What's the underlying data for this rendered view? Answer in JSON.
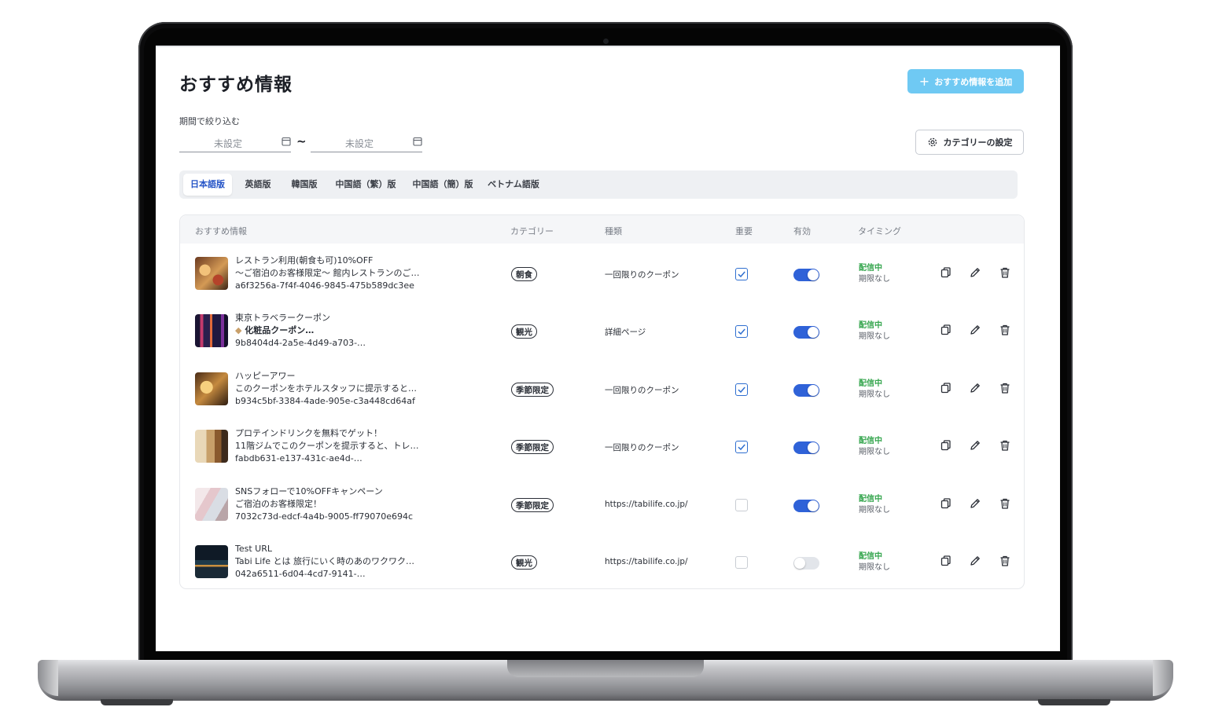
{
  "header": {
    "title": "おすすめ情報",
    "add_button": "おすすめ情報を追加"
  },
  "filter": {
    "label": "期間で絞り込む",
    "start_placeholder": "未設定",
    "end_placeholder": "未設定",
    "separator": "~"
  },
  "category_button": "カテゴリーの設定",
  "tabs": [
    {
      "label": "日本語版",
      "active": true
    },
    {
      "label": "英語版",
      "active": false
    },
    {
      "label": "韓国版",
      "active": false
    },
    {
      "label": "中国語（繁）版",
      "active": false
    },
    {
      "label": "中国語（簡）版",
      "active": false
    },
    {
      "label": "ベトナム語版",
      "active": false
    }
  ],
  "table": {
    "headers": [
      "おすすめ情報",
      "カテゴリー",
      "種類",
      "重要",
      "有効",
      "タイミング"
    ],
    "rows": [
      {
        "line1": "レストラン利用(朝食も可)10%OFF",
        "line2": "〜ご宿泊のお客様限定〜 館内レストランのご…",
        "line3": "a6f3256a-7f4f-4046-9845-475b589dc3ee",
        "category": "朝食",
        "kind": "一回限りのクーポン",
        "important": true,
        "active": true,
        "status": "配信中",
        "limit": "期限なし"
      },
      {
        "line1": "東京トラベラークーポン",
        "line2": "化粧品クーポン…",
        "line3": "9b8404d4-2a5e-4d49-a703-…",
        "category": "観光",
        "kind": "詳細ページ",
        "important": true,
        "active": true,
        "status": "配信中",
        "limit": "期限なし"
      },
      {
        "line1": "ハッピーアワー",
        "line2": "このクーポンをホテルスタッフに提示すると…",
        "line3": "b934c5bf-3384-4ade-905e-c3a448cd64af",
        "category": "季節限定",
        "kind": "一回限りのクーポン",
        "important": true,
        "active": true,
        "status": "配信中",
        "limit": "期限なし"
      },
      {
        "line1": "プロテインドリンクを無料でゲット！",
        "line2": "11階ジムでこのクーポンを提示すると、トレ…",
        "line3": "fabdb631-e137-431c-ae4d-…",
        "category": "季節限定",
        "kind": "一回限りのクーポン",
        "important": true,
        "active": true,
        "status": "配信中",
        "limit": "期限なし"
      },
      {
        "line1": "SNSフォローで10%OFFキャンペーン",
        "line2": "ご宿泊のお客様限定！",
        "line3": "7032c73d-edcf-4a4b-9005-ff79070e694c",
        "category": "季節限定",
        "kind": "https://tabilife.co.jp/",
        "important": false,
        "active": true,
        "status": "配信中",
        "limit": "期限なし"
      },
      {
        "line1": "Test URL",
        "line2": "Tabi Life とは 旅行にいく時のあのワクワク…",
        "line3": "042a6511-6d04-4cd7-9141-…",
        "category": "観光",
        "kind": "https://tabilife.co.jp/",
        "important": false,
        "active": false,
        "status": "配信中",
        "limit": "期限なし"
      }
    ]
  },
  "icons": {
    "row_actions": [
      "copy-icon",
      "edit-icon",
      "delete-icon"
    ],
    "filter": "calendar-icon",
    "settings": "gear-icon",
    "add": "plus-icon"
  },
  "colors": {
    "accent": "#2f62d8",
    "add_button": "#6fc9f3",
    "status_green": "#36a64f",
    "active_tab": "#2554c7"
  }
}
